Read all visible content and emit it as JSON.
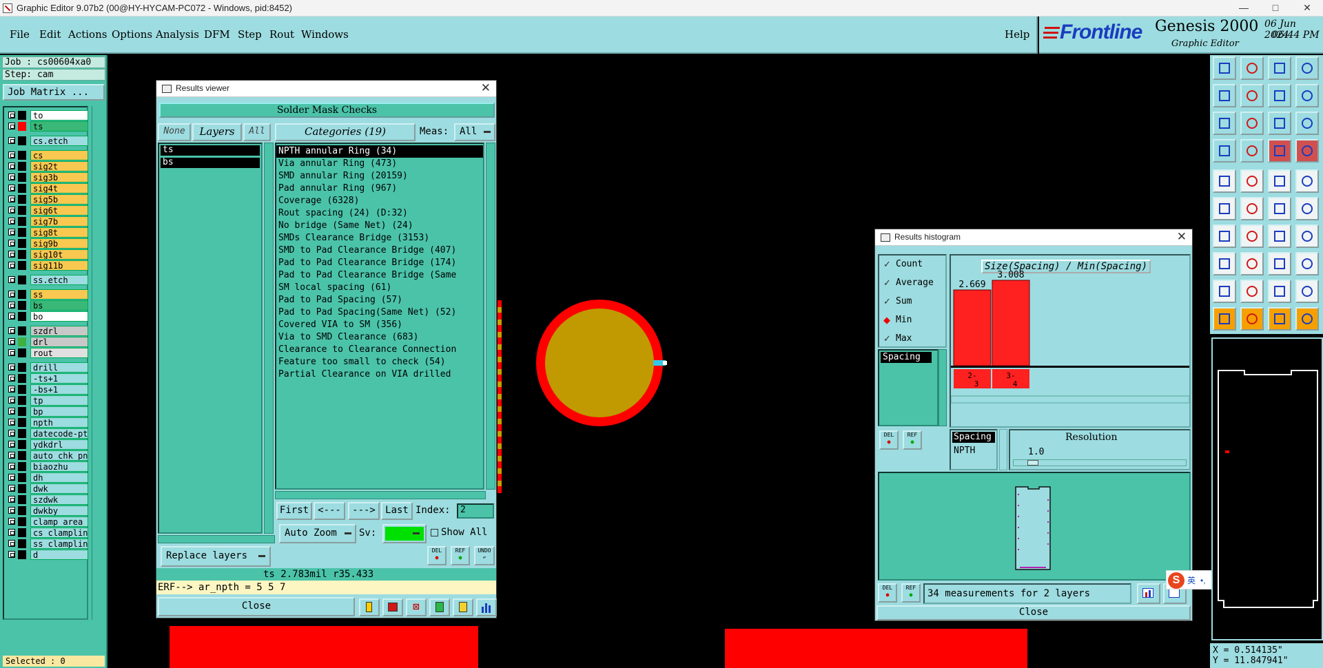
{
  "window": {
    "title": "Graphic Editor 9.07b2 (00@HY-HYCAM-PC072 - Windows, pid:8452)",
    "controls": [
      "—",
      "□",
      "✕"
    ]
  },
  "menu": {
    "items": [
      "File",
      "Edit",
      "Actions",
      "Options",
      "Analysis",
      "DFM",
      "Step",
      "Rout",
      "Windows"
    ],
    "help": "Help"
  },
  "brand": {
    "logo": "Frontline",
    "product": "Genesis 2000",
    "subtitle": "Graphic Editor",
    "date": "06 Jun 2024",
    "time": "06:44 PM"
  },
  "job": {
    "job_label": "Job : cs00604xa0",
    "step_label": "Step: cam",
    "matrix_button": "Job Matrix ...",
    "selected": "Selected : 0"
  },
  "layers": [
    {
      "name": "to",
      "color": "#000000",
      "bg": "#ffffff"
    },
    {
      "name": "ts",
      "color": "#ff0000",
      "bg": "#3ab878",
      "active": true
    },
    {
      "name": "cs.etch",
      "color": "#000000",
      "bg": "#9ddce0"
    },
    {
      "name": "cs",
      "color": "#000000",
      "bg": "#f8c850"
    },
    {
      "name": "sig2t",
      "color": "#000000",
      "bg": "#f8c850"
    },
    {
      "name": "sig3b",
      "color": "#000000",
      "bg": "#f8c850"
    },
    {
      "name": "sig4t",
      "color": "#000000",
      "bg": "#f8c850"
    },
    {
      "name": "sig5b",
      "color": "#000000",
      "bg": "#f8c850"
    },
    {
      "name": "sig6t",
      "color": "#000000",
      "bg": "#f8c850"
    },
    {
      "name": "sig7b",
      "color": "#000000",
      "bg": "#f8c850"
    },
    {
      "name": "sig8t",
      "color": "#000000",
      "bg": "#f8c850"
    },
    {
      "name": "sig9b",
      "color": "#000000",
      "bg": "#f8c850"
    },
    {
      "name": "sig10t",
      "color": "#000000",
      "bg": "#f8c850"
    },
    {
      "name": "sig11b",
      "color": "#000000",
      "bg": "#f8c850"
    },
    {
      "name": "ss.etch",
      "color": "#000000",
      "bg": "#9ddce0"
    },
    {
      "name": "ss",
      "color": "#000000",
      "bg": "#f8c850"
    },
    {
      "name": "bs",
      "color": "#000000",
      "bg": "#3ab878"
    },
    {
      "name": "bo",
      "color": "#000000",
      "bg": "#ffffff"
    },
    {
      "name": "szdrl",
      "color": "#000000",
      "bg": "#c8c8c8"
    },
    {
      "name": "drl",
      "color": "#40b040",
      "bg": "#c8c8c8"
    },
    {
      "name": "rout",
      "color": "#000000",
      "bg": "#e0e0e0"
    },
    {
      "name": "drill",
      "color": "#000000",
      "bg": "#9ddce0"
    },
    {
      "name": "-ts+1",
      "color": "#000000",
      "bg": "#9ddce0"
    },
    {
      "name": "-bs+1",
      "color": "#000000",
      "bg": "#9ddce0"
    },
    {
      "name": "tp",
      "color": "#000000",
      "bg": "#9ddce0"
    },
    {
      "name": "bp",
      "color": "#000000",
      "bg": "#9ddce0"
    },
    {
      "name": "npth",
      "color": "#000000",
      "bg": "#9ddce0"
    },
    {
      "name": "datecode-pto",
      "color": "#000000",
      "bg": "#9ddce0"
    },
    {
      "name": "ydkdrl",
      "color": "#000000",
      "bg": "#9ddce0"
    },
    {
      "name": "auto_chk_pn.",
      "color": "#000000",
      "bg": "#9ddce0"
    },
    {
      "name": "biaozhu",
      "color": "#000000",
      "bg": "#9ddce0"
    },
    {
      "name": "dh",
      "color": "#000000",
      "bg": "#9ddce0"
    },
    {
      "name": "dwk",
      "color": "#000000",
      "bg": "#9ddce0"
    },
    {
      "name": "szdwk",
      "color": "#000000",
      "bg": "#9ddce0"
    },
    {
      "name": "dwkby",
      "color": "#000000",
      "bg": "#9ddce0"
    },
    {
      "name": "clamp_area",
      "color": "#000000",
      "bg": "#9ddce0"
    },
    {
      "name": "cs_clampline",
      "color": "#000000",
      "bg": "#9ddce0"
    },
    {
      "name": "ss_clampline",
      "color": "#000000",
      "bg": "#9ddce0"
    },
    {
      "name": "d",
      "color": "#000000",
      "bg": "#9ddce0"
    }
  ],
  "results_viewer": {
    "title": "Results viewer",
    "heading": "Solder Mask Checks",
    "btn_none": "None",
    "btn_layers": "Layers",
    "btn_all": "All",
    "categories_label": "Categories (19)",
    "meas_label": "Meas:",
    "meas_value": "All",
    "layers": [
      "ts",
      "bs"
    ],
    "categories": [
      "NPTH annular Ring (34)",
      "Via annular Ring (473)",
      "SMD annular Ring (20159)",
      "Pad annular Ring (967)",
      "Coverage (6328)",
      "Rout spacing (24)          (D:32)",
      "No bridge (Same Net) (24)",
      "SMDs Clearance Bridge (3153)",
      "SMD to Pad Clearance Bridge (407)",
      "Pad to Pad Clearance Bridge (174)",
      "Pad to Pad Clearance Bridge (Same",
      "SM local spacing (61)",
      "Pad to Pad Spacing (57)",
      "Pad to Pad Spacing(Same Net) (52)",
      "Covered VIA to SM (356)",
      "Via to SMD Clearance (683)",
      "Clearance to Clearance Connection",
      "Feature too small to check (54)",
      "Partial Clearance on VIA drilled"
    ],
    "nav_first": "First",
    "nav_prev": "<---",
    "nav_next": "--->",
    "nav_last": "Last",
    "index_label": "Index:",
    "index_value": "2",
    "auto_zoom": "Auto Zoom",
    "sv_label": "Sv:",
    "show_all": "Show All",
    "replace_layers": "Replace layers",
    "btn_del": "DEL",
    "btn_ref": "REF",
    "btn_undo": "UNDO",
    "status": "ts 2.783mil  r35.433",
    "erf": "ERF--> ar_npth = 5 5 7",
    "close": "Close"
  },
  "results_histogram": {
    "title": "Results histogram",
    "options": [
      {
        "label": "Count",
        "type": "check"
      },
      {
        "label": "Average",
        "type": "check"
      },
      {
        "label": "Sum",
        "type": "check"
      },
      {
        "label": "Min",
        "type": "radio-selected"
      },
      {
        "label": "Max",
        "type": "check"
      }
    ],
    "measure_list": [
      "Spacing"
    ],
    "chart_heading": "Size(Spacing) / Min(Spacing)",
    "bars": [
      {
        "value": "2.669",
        "range": "2-\n3"
      },
      {
        "value": "3.008",
        "range": "3-\n4"
      }
    ],
    "legend_spacing": "Spacing",
    "legend_npth": "NPTH",
    "resolution_label": "Resolution",
    "resolution_value": "1.0",
    "btn_del": "DEL",
    "btn_ref": "REF",
    "summary": "34 measurements for 2 layers",
    "close": "Close",
    "chart_data": {
      "type": "bar",
      "categories": [
        "2-3",
        "3-4"
      ],
      "values": [
        2.669,
        3.008
      ],
      "title": "Size(Spacing) / Min(Spacing)"
    }
  },
  "ime": {
    "labels": [
      "英",
      "•,",
      "🎙",
      "⌨",
      "👕",
      "🎮",
      "☷",
      "⚙"
    ]
  },
  "coords": {
    "x": "X = 0.514135\"",
    "y": "Y = 11.847941\""
  }
}
